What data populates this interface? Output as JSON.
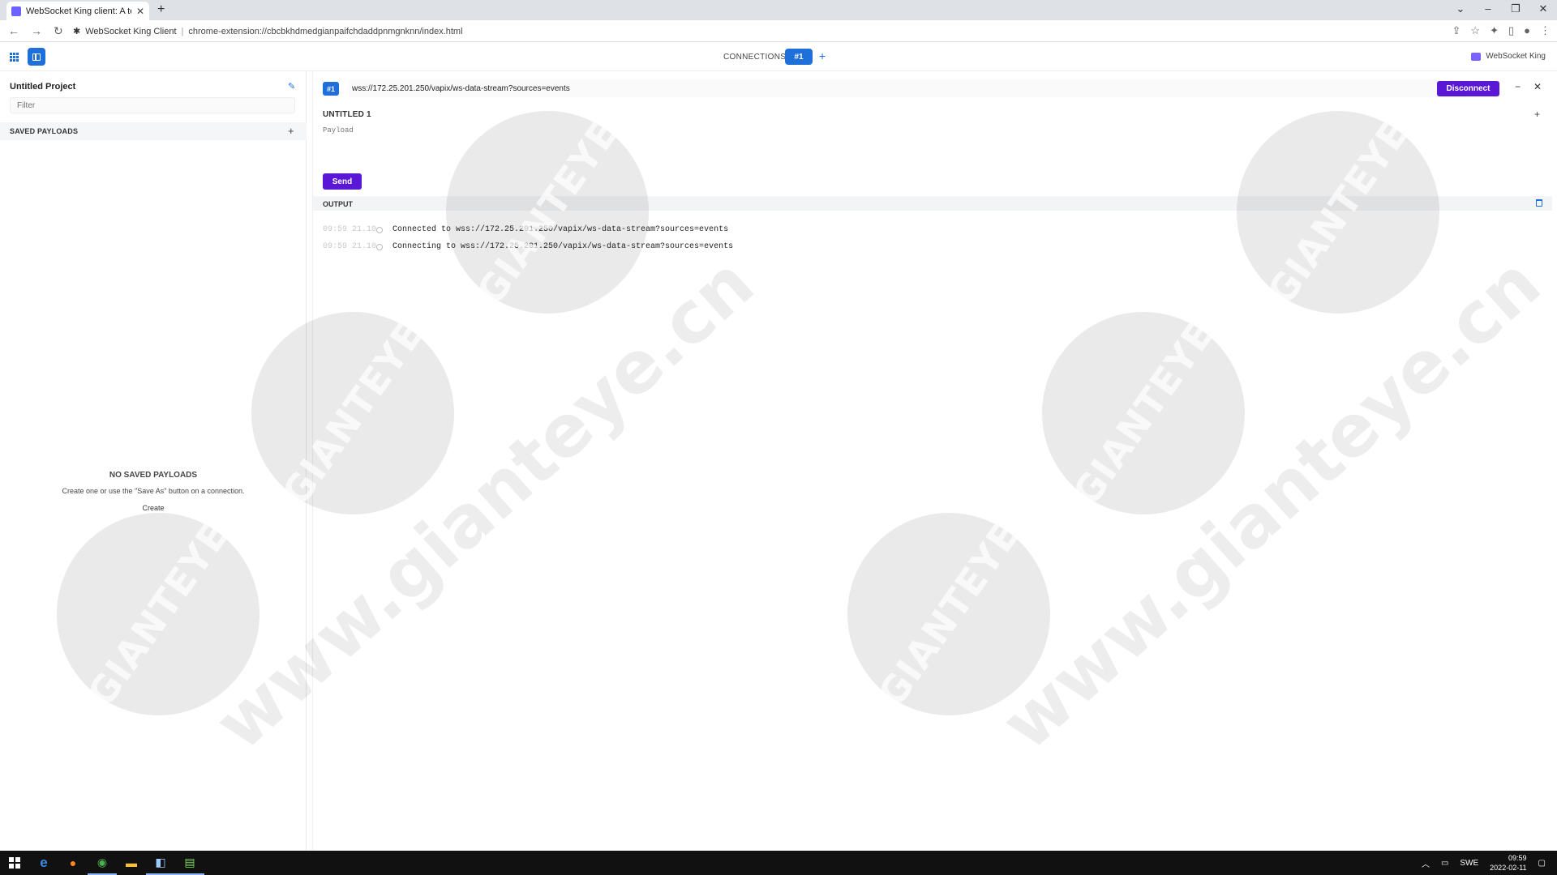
{
  "browser": {
    "tab_title": "WebSocket King client: A testing",
    "address_site": "WebSocket King Client",
    "address_url": "chrome-extension://cbcbkhdmedgianpaifchdaddpnmgnknn/index.html"
  },
  "app": {
    "connections_label": "CONNECTIONS",
    "active_connection": "#1",
    "brand": "WebSocket King"
  },
  "sidebar": {
    "project_title": "Untitled Project",
    "filter_placeholder": "Filter",
    "saved_payloads_label": "SAVED PAYLOADS",
    "empty_title": "NO SAVED PAYLOADS",
    "empty_desc": "Create one or use the \"Save As\" button on a connection.",
    "create_label": "Create"
  },
  "connection": {
    "badge": "#1",
    "url": "wss://172.25.201.250/vapix/ws-data-stream?sources=events",
    "disconnect_label": "Disconnect",
    "payload_title": "UNTITLED 1",
    "payload_placeholder": "Payload",
    "send_label": "Send",
    "output_label": "OUTPUT"
  },
  "log": [
    {
      "time": "09:59 21.10",
      "message": "Connected to wss://172.25.201.250/vapix/ws-data-stream?sources=events"
    },
    {
      "time": "09:59 21.10",
      "message": "Connecting to wss://172.25.201.250/vapix/ws-data-stream?sources=events"
    }
  ],
  "watermark": {
    "logo_text": "GIANTEYE",
    "url_text": "www.gianteye.cn"
  },
  "taskbar": {
    "language": "SWE",
    "time": "09:59",
    "date": "2022-02-11"
  },
  "colors": {
    "primary_blue": "#1e6fd9",
    "action_purple": "#5b17d6"
  }
}
